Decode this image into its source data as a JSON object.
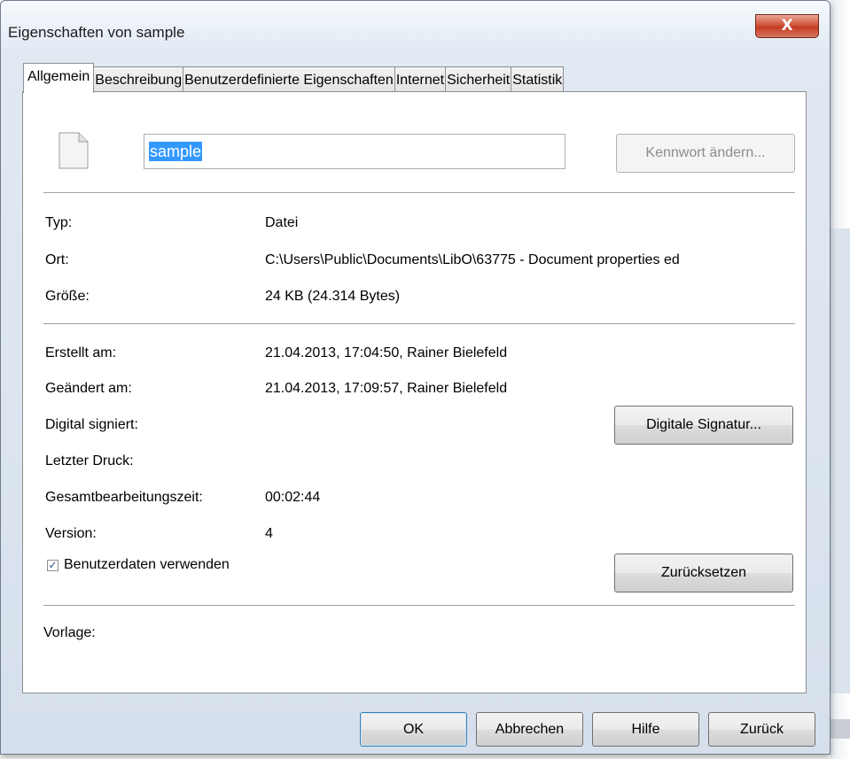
{
  "window": {
    "title": "Eigenschaften von sample",
    "close_label": "X"
  },
  "tabs": [
    {
      "label": "Allgemein",
      "active": true
    },
    {
      "label": "Beschreibung",
      "active": false
    },
    {
      "label": "Benutzerdefinierte Eigenschaften",
      "active": false
    },
    {
      "label": "Internet",
      "active": false
    },
    {
      "label": "Sicherheit",
      "active": false
    },
    {
      "label": "Statistik",
      "active": false
    }
  ],
  "general": {
    "file_icon": "document-icon",
    "name_value": "sample",
    "change_password_button": "Kennwort ändern...",
    "type_label": "Typ:",
    "type_value": "Datei",
    "location_label": "Ort:",
    "location_value": "C:\\Users\\Public\\Documents\\LibO\\63775 - Document properties ed",
    "size_label": "Größe:",
    "size_value": "24 KB (24.314 Bytes)",
    "created_label": "Erstellt am:",
    "created_value": "21.04.2013, 17:04:50, Rainer Bielefeld",
    "modified_label": "Geändert am:",
    "modified_value": "21.04.2013, 17:09:57, Rainer Bielefeld",
    "signed_label": "Digital signiert:",
    "digital_signature_button": "Digitale Signatur...",
    "last_print_label": "Letzter Druck:",
    "editing_time_label": "Gesamtbearbeitungszeit:",
    "editing_time_value": "00:02:44",
    "version_label": "Version:",
    "version_value": "4",
    "use_user_data_label": "Benutzerdaten verwenden",
    "use_user_data_checked": true,
    "reset_button": "Zurücksetzen",
    "template_label": "Vorlage:"
  },
  "buttons": {
    "ok": "OK",
    "cancel": "Abbrechen",
    "help": "Hilfe",
    "back": "Zurück"
  },
  "colors": {
    "selection": "#3399ff",
    "close_button": "#c8452b",
    "default_button_border": "#3c7fb1"
  }
}
